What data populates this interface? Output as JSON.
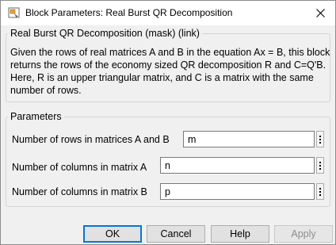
{
  "window": {
    "title": "Block Parameters: Real Burst QR Decomposition",
    "close_glyph": "✕"
  },
  "mask_group": {
    "title": "Real Burst QR Decomposition (mask) (link)",
    "description": "Given the rows of real matrices A and B in the equation Ax = B, this block returns the rows of the economy sized QR decomposition R and C=Q'B. Here, R is an upper triangular matrix, and C is a matrix with the same number of rows."
  },
  "params_group": {
    "title": "Parameters",
    "fields": [
      {
        "label": "Number of rows in matrices A and B",
        "value": "m"
      },
      {
        "label": "Number of columns in matrix A",
        "value": "n"
      },
      {
        "label": "Number of columns in matrix B",
        "value": "p"
      }
    ]
  },
  "buttons": {
    "ok": "OK",
    "cancel": "Cancel",
    "help": "Help",
    "apply": "Apply"
  },
  "colors": {
    "accent": "#0078d7",
    "dialog_bg": "#f0f0f0",
    "titlebar_bg": "#ffffff"
  }
}
